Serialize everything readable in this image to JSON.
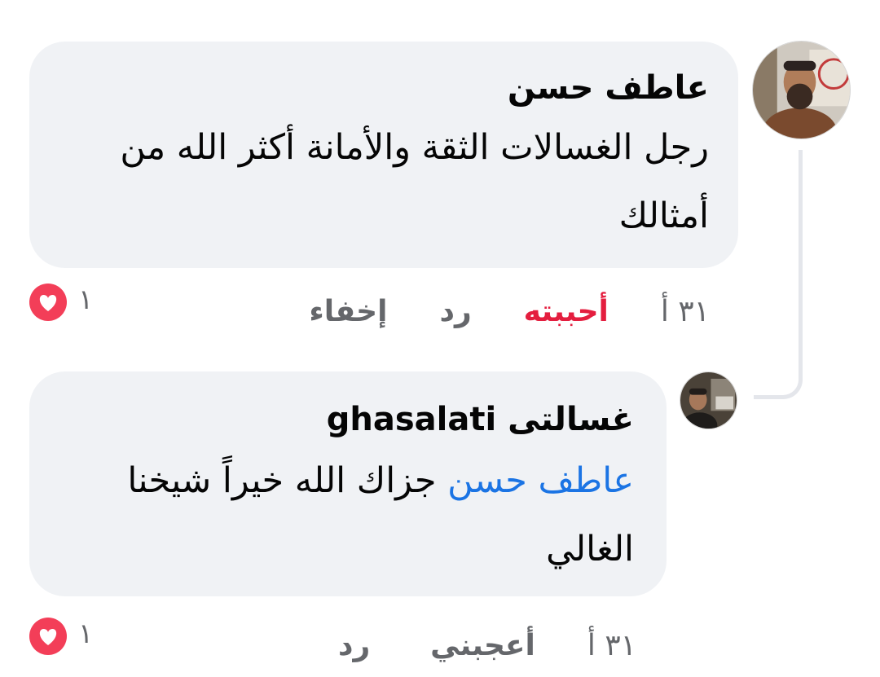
{
  "comments": [
    {
      "author": "عاطف حسن",
      "text": "رجل الغسالات الثقة والأمانة أكثر الله من أمثالك",
      "time": "٣١ أ",
      "like_label": "أحببته",
      "reply_label": "رد",
      "hide_label": "إخفاء",
      "reaction_count": "١",
      "reaction_type": "love"
    },
    {
      "author": "غسالتى ghasalati",
      "mention": "عاطف حسن",
      "text": "جزاك الله خيراً شيخنا الغالي",
      "time": "٣١ أ",
      "like_label": "أعجبني",
      "reply_label": "رد",
      "reaction_count": "١",
      "reaction_type": "love"
    }
  ],
  "colors": {
    "bubble_bg": "#f0f2f5",
    "text": "#050505",
    "meta": "#65676b",
    "loved": "#e41e3f",
    "mention": "#1b74e4"
  }
}
